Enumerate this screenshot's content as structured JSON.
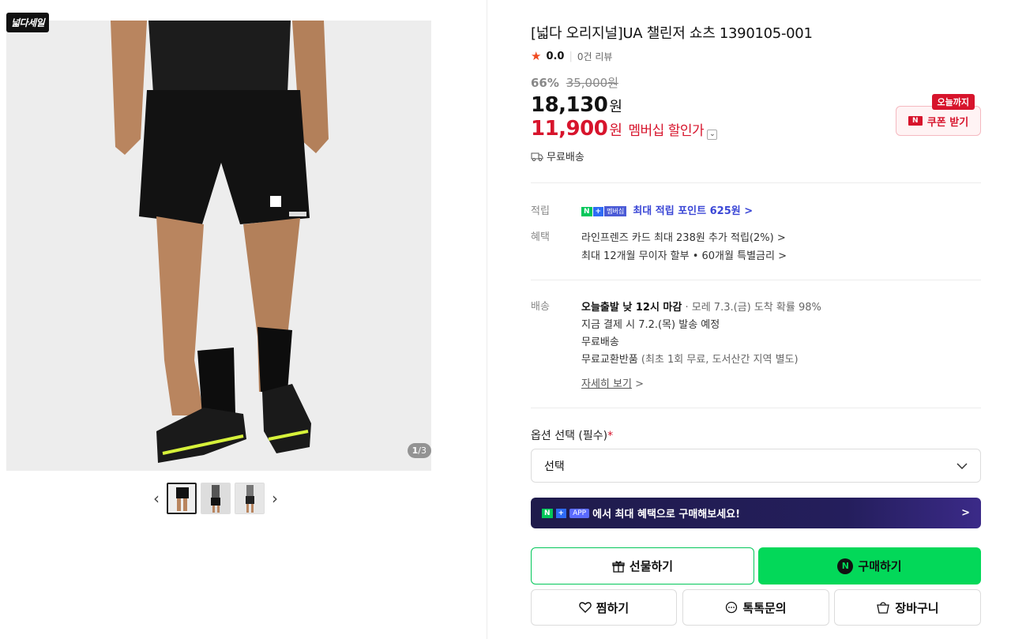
{
  "gallery": {
    "badge": "넓다세일",
    "counter_current": "1",
    "counter_total": "/3"
  },
  "product": {
    "title": "[넓다 오리지널]UA 챌린저 쇼츠 1390105-001",
    "rating_score": "0.0",
    "review_count": "0건 리뷰",
    "discount_rate": "66%",
    "original_price": "35,000원",
    "price": "18,130",
    "price_unit": "원",
    "member_price": "11,900",
    "member_price_unit": "원",
    "member_label": "멤버십 할인가",
    "shipping_short": "무료배송"
  },
  "coupon": {
    "tag": "오늘까지",
    "label": "쿠폰 받기"
  },
  "benefits": {
    "point_label": "적립",
    "point_badge_n": "N",
    "point_badge_plus": "+",
    "point_badge_mem": "멤버십",
    "point_text": "최대 적립 포인트 625원 >",
    "benefit_label": "혜택",
    "benefit_line1": "라인프렌즈 카드 최대 238원 추가 적립(2%) >",
    "benefit_line2": "최대 12개월 무이자 할부 • 60개월 특별금리 >"
  },
  "delivery": {
    "label": "배송",
    "line1_bold": "오늘출발 낮 12시 마감",
    "line1_rest": " · 모레 7.3.(금) 도착 확률 98%",
    "line2": "지금 결제 시 7.2.(목) 발송 예정",
    "line3": "무료배송",
    "line4_main": "무료교환반품",
    "line4_note": " (최초 1회 무료, 도서산간 지역 별도)",
    "detail_link": "자세히 보기",
    "detail_chevron": ">"
  },
  "options": {
    "label": "옵션 선택 (필수)",
    "required_mark": "*",
    "select_value": "선택"
  },
  "app_banner": {
    "tag_n": "N",
    "tag_plus": "+",
    "tag_app": "APP",
    "text": "에서 최대 혜택으로 구매해보세요!",
    "chevron": ">"
  },
  "actions": {
    "gift": "선물하기",
    "buy": "구매하기",
    "wish": "찜하기",
    "talk": "톡톡문의",
    "cart": "장바구니"
  },
  "colors": {
    "accent_red": "#d7142c",
    "naver_green": "#03c75a",
    "point_blue": "#3b47d6"
  }
}
